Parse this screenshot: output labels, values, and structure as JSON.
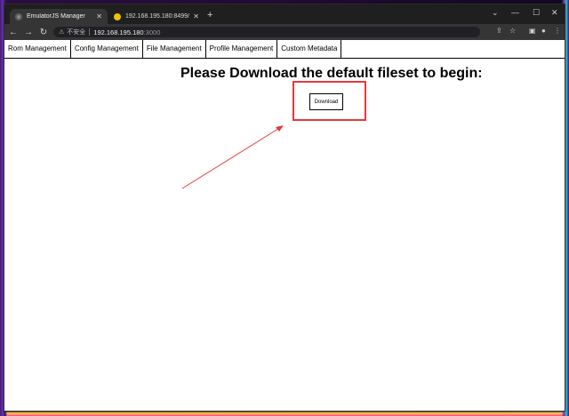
{
  "browser": {
    "tabs": [
      {
        "title": "EmulatorJS Manager",
        "favicon": "gear-icon",
        "active": true
      },
      {
        "title": "192.168.195.180:8499/filebrow",
        "favicon": "pacman-icon",
        "active": false
      }
    ],
    "address": {
      "security_label": "不安全",
      "host": "192.168.195.180",
      "port": ":3000"
    }
  },
  "menu": {
    "items": [
      "Rom Management",
      "Config Management",
      "File Management",
      "Profile Management",
      "Custom Metadata"
    ]
  },
  "main": {
    "heading": "Please Download the default fileset to begin:",
    "download_label": "Download"
  },
  "annotation_color": "#e23a3a"
}
